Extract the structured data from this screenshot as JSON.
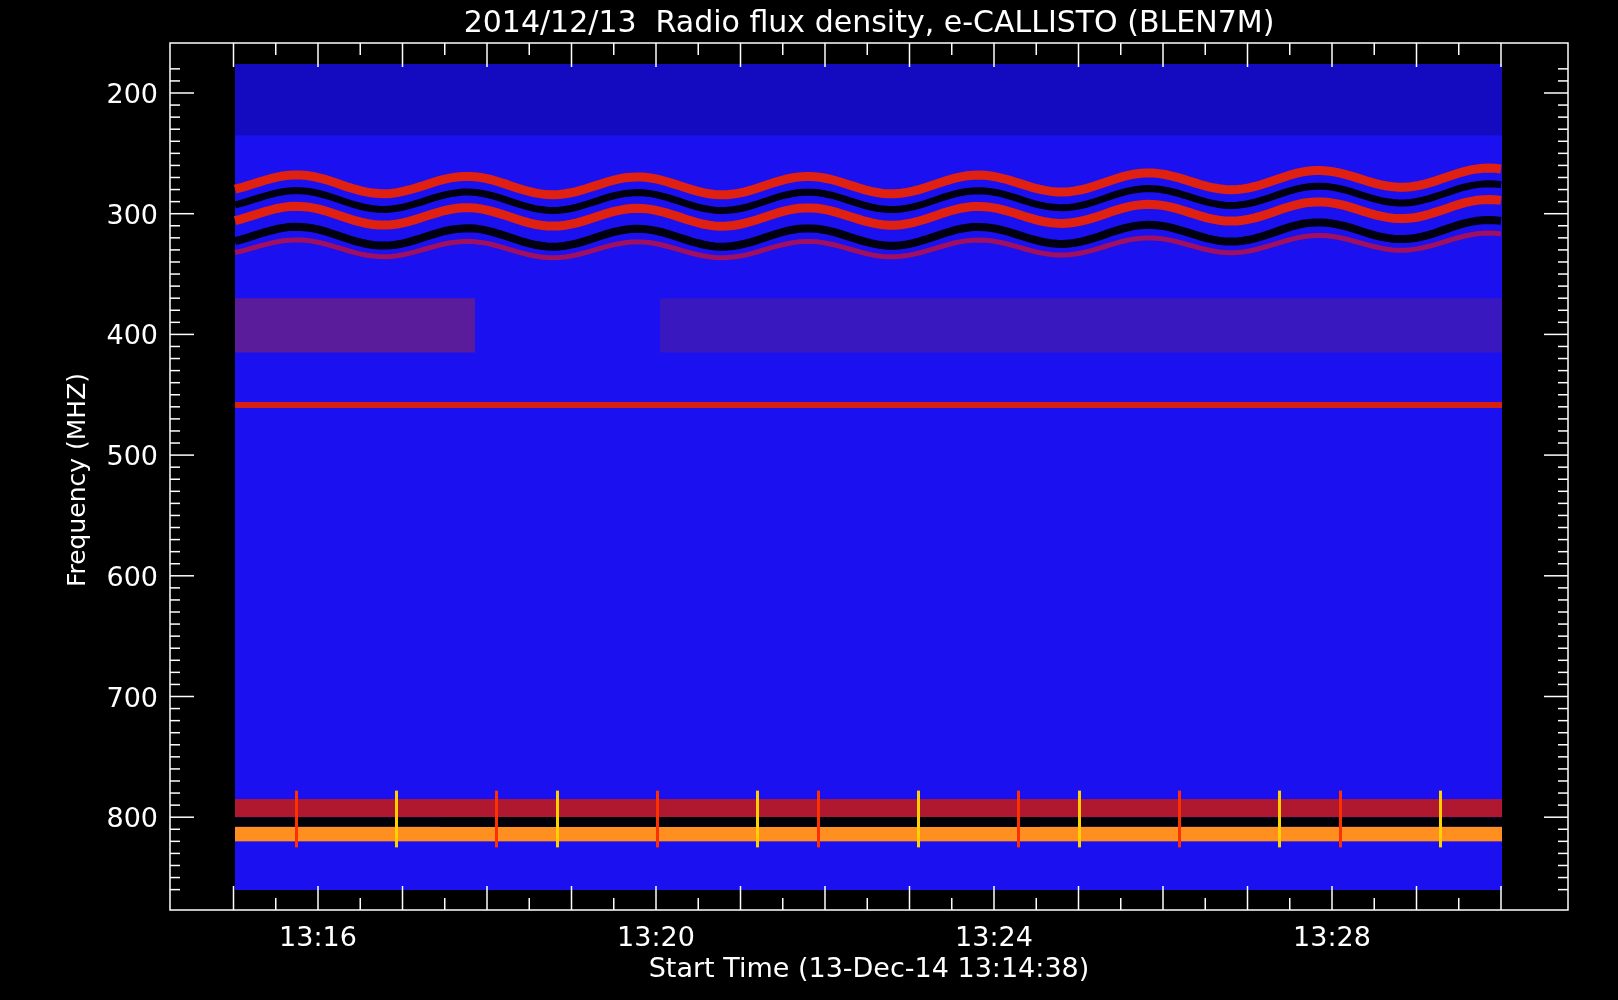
{
  "title": "2014/12/13  Radio flux density, e-CALLISTO (BLEN7M)",
  "y_axis": {
    "label": "Frequency (MHZ)",
    "ticks": [
      "200",
      "300",
      "400",
      "500",
      "600",
      "700",
      "800"
    ]
  },
  "x_axis": {
    "label": "Start Time (13-Dec-14 13:14:38)",
    "ticks": [
      "13:16",
      "13:20",
      "13:24",
      "13:28"
    ]
  }
}
